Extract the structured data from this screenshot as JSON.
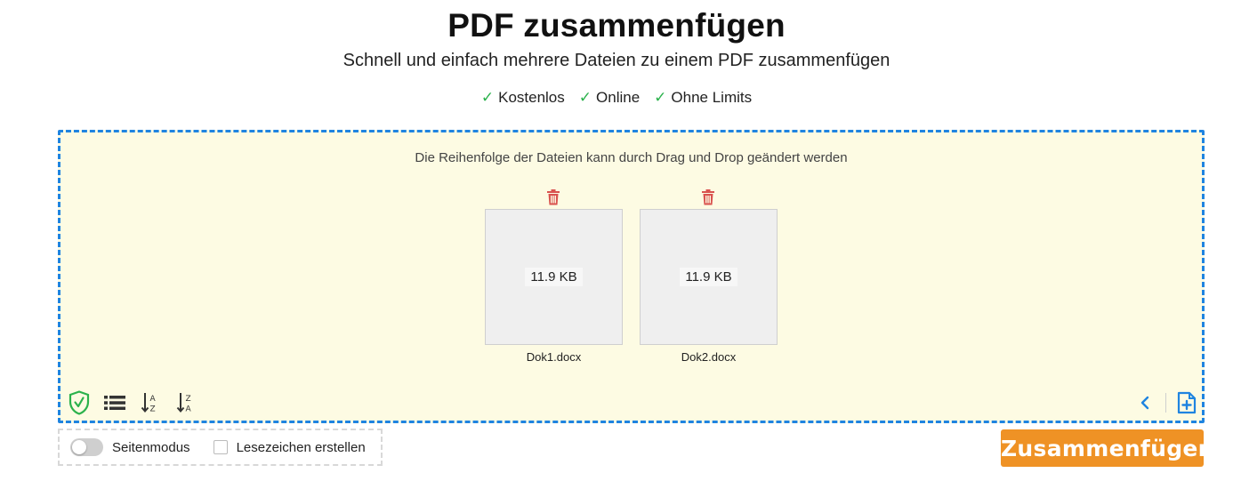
{
  "header": {
    "title": "PDF zusammenfügen",
    "subtitle": "Schnell und einfach mehrere Dateien zu einem PDF zusammenfügen",
    "features": [
      "Kostenlos",
      "Online",
      "Ohne Limits"
    ],
    "check_glyph": "✓"
  },
  "dropzone": {
    "hint": "Die Reihenfolge der Dateien kann durch Drag und Drop geändert werden",
    "files": [
      {
        "name": "Dok1.docx",
        "size": "11.9 KB"
      },
      {
        "name": "Dok2.docx",
        "size": "11.9 KB"
      }
    ],
    "toolbar_left_icons": [
      "shield-check-icon",
      "list-view-icon",
      "sort-a-z-icon",
      "sort-z-a-icon"
    ],
    "toolbar_right_icons": [
      "chevron-left-icon",
      "add-file-icon"
    ]
  },
  "options": {
    "page_mode_label": "Seitenmodus",
    "page_mode_on": false,
    "bookmarks_label": "Lesezeichen erstellen",
    "bookmarks_checked": false
  },
  "actions": {
    "merge_label": "Zusammenfügen"
  },
  "colors": {
    "accent_blue": "#1f84e0",
    "drop_bg": "#fdfbe3",
    "merge_orange": "#ef9225",
    "check_green": "#2bb24c",
    "trash_red": "#d9534f"
  }
}
